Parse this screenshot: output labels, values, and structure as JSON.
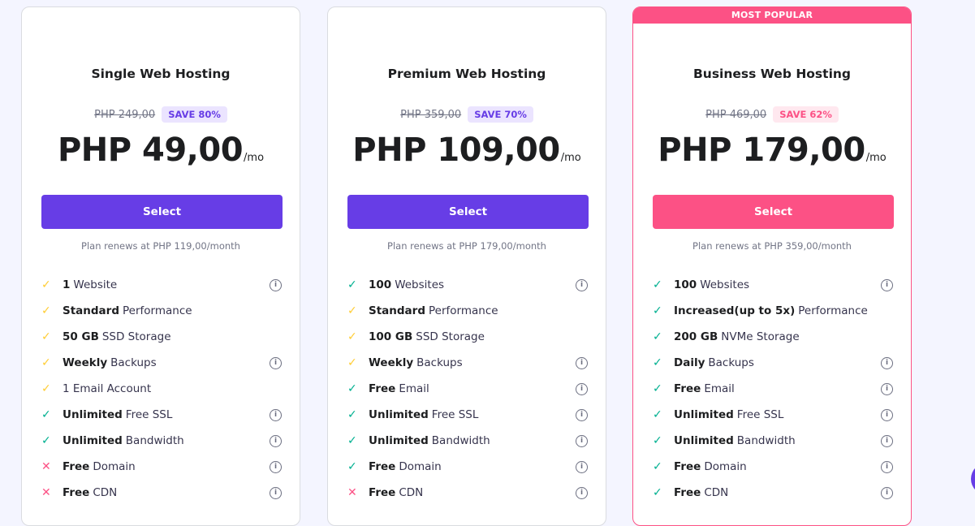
{
  "plans": [
    {
      "id": "single",
      "badge": "",
      "title": "Single Web Hosting",
      "old_price": "PHP 249,00",
      "save": "SAVE 80%",
      "price": "PHP 49,00",
      "per": "/mo",
      "select_label": "Select",
      "renews": "Plan renews at PHP 119,00/month",
      "features": [
        {
          "bold": "1",
          "text": "Website",
          "mark": "yellow-check",
          "info": true
        },
        {
          "bold": "Standard",
          "text": "Performance",
          "mark": "yellow-check",
          "info": false
        },
        {
          "bold": "50 GB",
          "text": "SSD Storage",
          "mark": "yellow-check",
          "info": false
        },
        {
          "bold": "Weekly",
          "text": "Backups",
          "mark": "yellow-check",
          "info": true
        },
        {
          "bold": "",
          "text": "1 Email Account",
          "mark": "yellow-check",
          "info": false
        },
        {
          "bold": "Unlimited",
          "text": "Free SSL",
          "mark": "green-check",
          "info": true
        },
        {
          "bold": "Unlimited",
          "text": "Bandwidth",
          "mark": "green-check",
          "info": true
        },
        {
          "bold": "Free",
          "text": "Domain",
          "mark": "red-cross",
          "info": true
        },
        {
          "bold": "Free",
          "text": "CDN",
          "mark": "red-cross",
          "info": true
        }
      ]
    },
    {
      "id": "premium",
      "badge": "",
      "title": "Premium Web Hosting",
      "old_price": "PHP 359,00",
      "save": "SAVE 70%",
      "price": "PHP 109,00",
      "per": "/mo",
      "select_label": "Select",
      "renews": "Plan renews at PHP 179,00/month",
      "features": [
        {
          "bold": "100",
          "text": "Websites",
          "mark": "green-check",
          "info": true
        },
        {
          "bold": "Standard",
          "text": "Performance",
          "mark": "yellow-check",
          "info": false
        },
        {
          "bold": "100 GB",
          "text": "SSD Storage",
          "mark": "yellow-check",
          "info": false
        },
        {
          "bold": "Weekly",
          "text": "Backups",
          "mark": "yellow-check",
          "info": true
        },
        {
          "bold": "Free",
          "text": "Email",
          "mark": "green-check",
          "info": true
        },
        {
          "bold": "Unlimited",
          "text": "Free SSL",
          "mark": "green-check",
          "info": true
        },
        {
          "bold": "Unlimited",
          "text": "Bandwidth",
          "mark": "green-check",
          "info": true
        },
        {
          "bold": "Free",
          "text": "Domain",
          "mark": "green-check",
          "info": true
        },
        {
          "bold": "Free",
          "text": "CDN",
          "mark": "red-cross",
          "info": true
        }
      ]
    },
    {
      "id": "business",
      "badge": "MOST POPULAR",
      "title": "Business Web Hosting",
      "old_price": "PHP 469,00",
      "save": "SAVE 62%",
      "price": "PHP 179,00",
      "per": "/mo",
      "select_label": "Select",
      "renews": "Plan renews at PHP 359,00/month",
      "features": [
        {
          "bold": "100",
          "text": "Websites",
          "mark": "green-check",
          "info": true
        },
        {
          "bold": "Increased(up to 5x)",
          "text": "Performance",
          "mark": "green-check",
          "info": false
        },
        {
          "bold": "200 GB",
          "text": "NVMe Storage",
          "mark": "green-check",
          "info": false
        },
        {
          "bold": "Daily",
          "text": "Backups",
          "mark": "green-check",
          "info": true
        },
        {
          "bold": "Free",
          "text": "Email",
          "mark": "green-check",
          "info": true
        },
        {
          "bold": "Unlimited",
          "text": "Free SSL",
          "mark": "green-check",
          "info": true
        },
        {
          "bold": "Unlimited",
          "text": "Bandwidth",
          "mark": "green-check",
          "info": true
        },
        {
          "bold": "Free",
          "text": "Domain",
          "mark": "green-check",
          "info": true
        },
        {
          "bold": "Free",
          "text": "CDN",
          "mark": "green-check",
          "info": true
        }
      ]
    }
  ],
  "colors": {
    "primary": "#673de6",
    "accent_pink": "#fc5185",
    "check_green": "#00b090",
    "check_yellow": "#ffcd35"
  }
}
